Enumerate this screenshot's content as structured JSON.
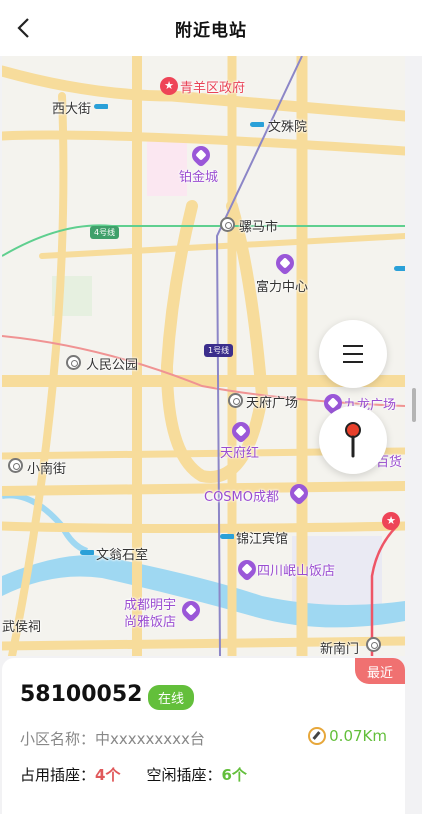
{
  "header": {
    "title": "附近电站",
    "back_icon": "chevron-left-icon"
  },
  "map": {
    "labels": {
      "xida": "西大街",
      "qingyang": "青羊区政府",
      "wenshu": "文殊院",
      "bojin": "铂金城",
      "line4": "4号线",
      "luoma": "骡马市",
      "fuli": "富力中心",
      "renmin": "人民公园",
      "line1": "1号线",
      "tianfu_sq": "天府广场",
      "jiulong": "九龙广场",
      "tianfuhong": "天府红",
      "baihuo": "百货",
      "xiaonan": "小南街",
      "cosmo": "COSMO成都",
      "jinjiang": "锦江宾馆",
      "sichuan_emei": "四川岷山饭店",
      "wenweng": "文翁石室",
      "chengdu_mingyu": "成都明宇",
      "shangya": "尚雅饭店",
      "wuhou": "武侯祠",
      "xinnanmen": "新南门"
    }
  },
  "controls": {
    "menu_icon": "menu-icon",
    "locate_icon": "location-pin-icon"
  },
  "station": {
    "nearest_tag": "最近",
    "code": "58100052",
    "status": "在线",
    "community_label": "小区名称：",
    "community_name": "中xxxxxxxxx台",
    "distance": "0.07Km",
    "occupied_label": "占用插座：",
    "occupied_value": "4个",
    "free_label": "空闲插座：",
    "free_value": "6个",
    "colors": {
      "online": "#63bf3b",
      "occupied": "#e0595b",
      "tag": "#f07171"
    }
  }
}
